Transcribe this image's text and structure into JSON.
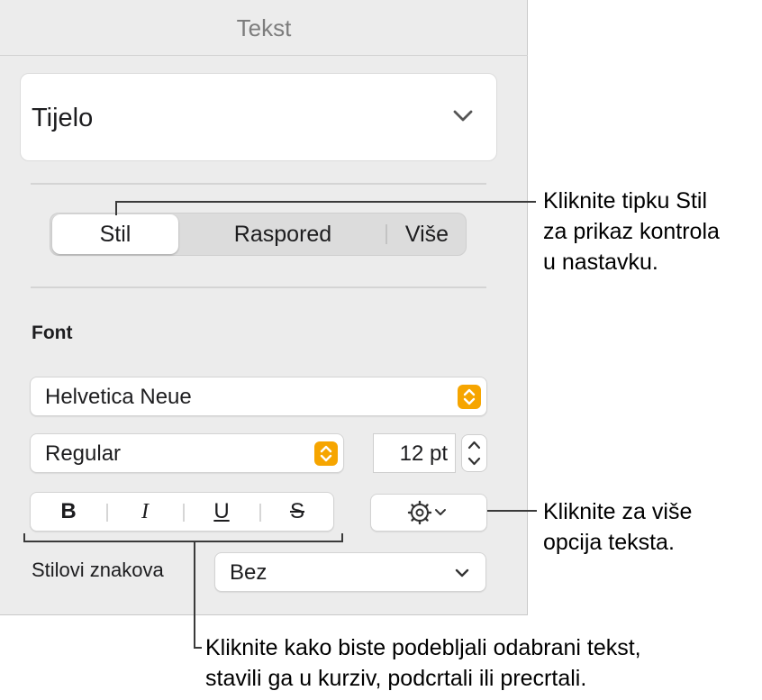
{
  "panel": {
    "title": "Tekst",
    "paragraph_style": "Tijelo",
    "tabs": [
      "Stil",
      "Raspored",
      "Više"
    ],
    "active_tab": "Stil",
    "font_section": "Font",
    "font_family": "Helvetica Neue",
    "font_typeface": "Regular",
    "font_size": "12 pt",
    "format_buttons": {
      "bold": "B",
      "italic": "I",
      "underline": "U",
      "strikethrough": "S"
    },
    "char_styles_label": "Stilovi znakova",
    "char_styles_value": "Bez",
    "accent_color": "#f6a500"
  },
  "callouts": {
    "tab": [
      "Kliknite tipku Stil",
      "za prikaz kontrola",
      "u nastavku."
    ],
    "gear": [
      "Kliknite za više",
      "opcija teksta."
    ],
    "format": [
      "Kliknite kako biste podebljali odabrani tekst,",
      "stavili ga u kurziv, podcrtali ili precrtali."
    ]
  }
}
